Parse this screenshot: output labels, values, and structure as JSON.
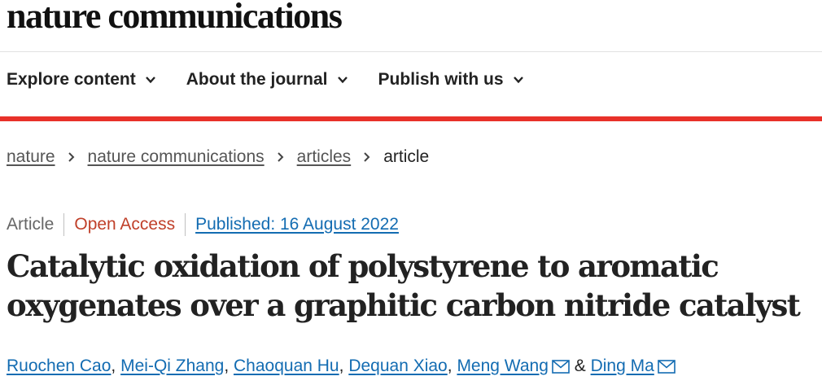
{
  "brand": {
    "name": "nature communications"
  },
  "nav": {
    "items": [
      {
        "label": "Explore content",
        "icon": "chevron-down-icon"
      },
      {
        "label": "About the journal",
        "icon": "chevron-down-icon"
      },
      {
        "label": "Publish with us",
        "icon": "chevron-down-icon"
      }
    ]
  },
  "breadcrumb": {
    "items": [
      "nature",
      "nature communications",
      "articles"
    ],
    "current": "article"
  },
  "article": {
    "type": "Article",
    "access": "Open Access",
    "published": "Published: 16 August 2022",
    "title_line1": "Catalytic oxidation of polystyrene to aromatic",
    "title_line2": "oxygenates over a graphitic carbon nitride catalyst",
    "authors": [
      "Ruochen Cao",
      "Mei-Qi Zhang",
      "Chaoquan Hu",
      "Dequan Xiao",
      "Meng Wang",
      "Ding Ma"
    ],
    "author_separator": ",",
    "author_and": "&"
  },
  "colors": {
    "accent_red": "#e8312a",
    "link_blue": "#136cb2",
    "open_access": "#c0402a"
  }
}
